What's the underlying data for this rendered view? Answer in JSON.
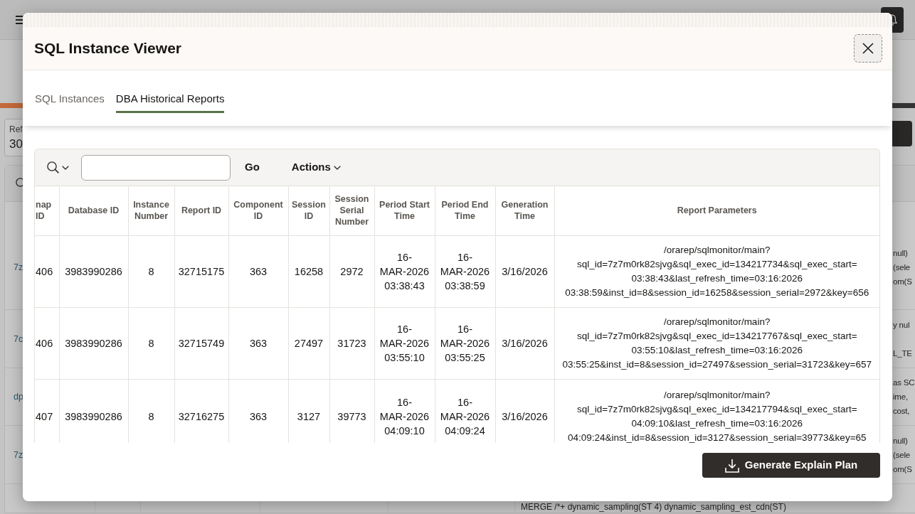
{
  "background_page": {
    "refresh_field": {
      "label": "Ref",
      "value": "30"
    },
    "rows": [
      {
        "column_1": "7z",
        "column_last": [
          "null)",
          "(sele",
          "om(S"
        ]
      },
      {
        "column_1": "7c",
        "column_last": [
          "y nul",
          "L_TE"
        ]
      },
      {
        "column_1": "dp",
        "column_last": [
          "as SC",
          "ime,",
          "cost,"
        ]
      },
      {
        "column_1": "7z",
        "column_last": [
          "null)",
          "(sele",
          "om(S"
        ]
      }
    ],
    "last_row_text": "MERGE /*+ dynamic_sampling(ST 4) dynamic_sampling_est_cdn(ST)"
  },
  "dialog": {
    "title": "SQL Instance Viewer",
    "tabs": [
      {
        "label": "SQL Instances",
        "selected": false
      },
      {
        "label": "DBA Historical Reports",
        "selected": true
      }
    ],
    "toolbar": {
      "go_button": "Go",
      "actions_button": "Actions"
    },
    "table": {
      "columns": [
        "nap ID",
        "Database ID",
        "Instance Number",
        "Report ID",
        "Component ID",
        "Session ID",
        "Session Serial Number",
        "Period Start Time",
        "Period End Time",
        "Generation Time",
        "Report Parameters"
      ],
      "rows": [
        [
          "406",
          "3983990286",
          "8",
          "32715175",
          "363",
          "16258",
          "2972",
          "16-\nMAR-2026\n03:38:43",
          "16-\nMAR-2026\n03:38:59",
          "3/16/2026",
          "/orarep/sqlmonitor/main?\nsql_id=7z7m0rk82sjvg&sql_exec_id=134217734&sql_exec_start=\n03:38:43&last_refresh_time=03:16:2026\n03:38:59&inst_id=8&session_id=16258&session_serial=2972&key=656"
        ],
        [
          "406",
          "3983990286",
          "8",
          "32715749",
          "363",
          "27497",
          "31723",
          "16-\nMAR-2026\n03:55:10",
          "16-\nMAR-2026\n03:55:25",
          "3/16/2026",
          "/orarep/sqlmonitor/main?\nsql_id=7z7m0rk82sjvg&sql_exec_id=134217767&sql_exec_start=\n03:55:10&last_refresh_time=03:16:2026\n03:55:25&inst_id=8&session_id=27497&session_serial=31723&key=657"
        ],
        [
          "407",
          "3983990286",
          "8",
          "32716275",
          "363",
          "3127",
          "39773",
          "16-\nMAR-2026\n04:09:10",
          "16-\nMAR-2026\n04:09:24",
          "3/16/2026",
          "/orarep/sqlmonitor/main?\nsql_id=7z7m0rk82sjvg&sql_exec_id=134217794&sql_exec_start=\n04:09:10&last_refresh_time=03:16:2026\n04:09:24&inst_id=8&session_id=3127&session_serial=39773&key=65"
        ]
      ]
    },
    "footer_button": "Generate Explain Plan"
  }
}
